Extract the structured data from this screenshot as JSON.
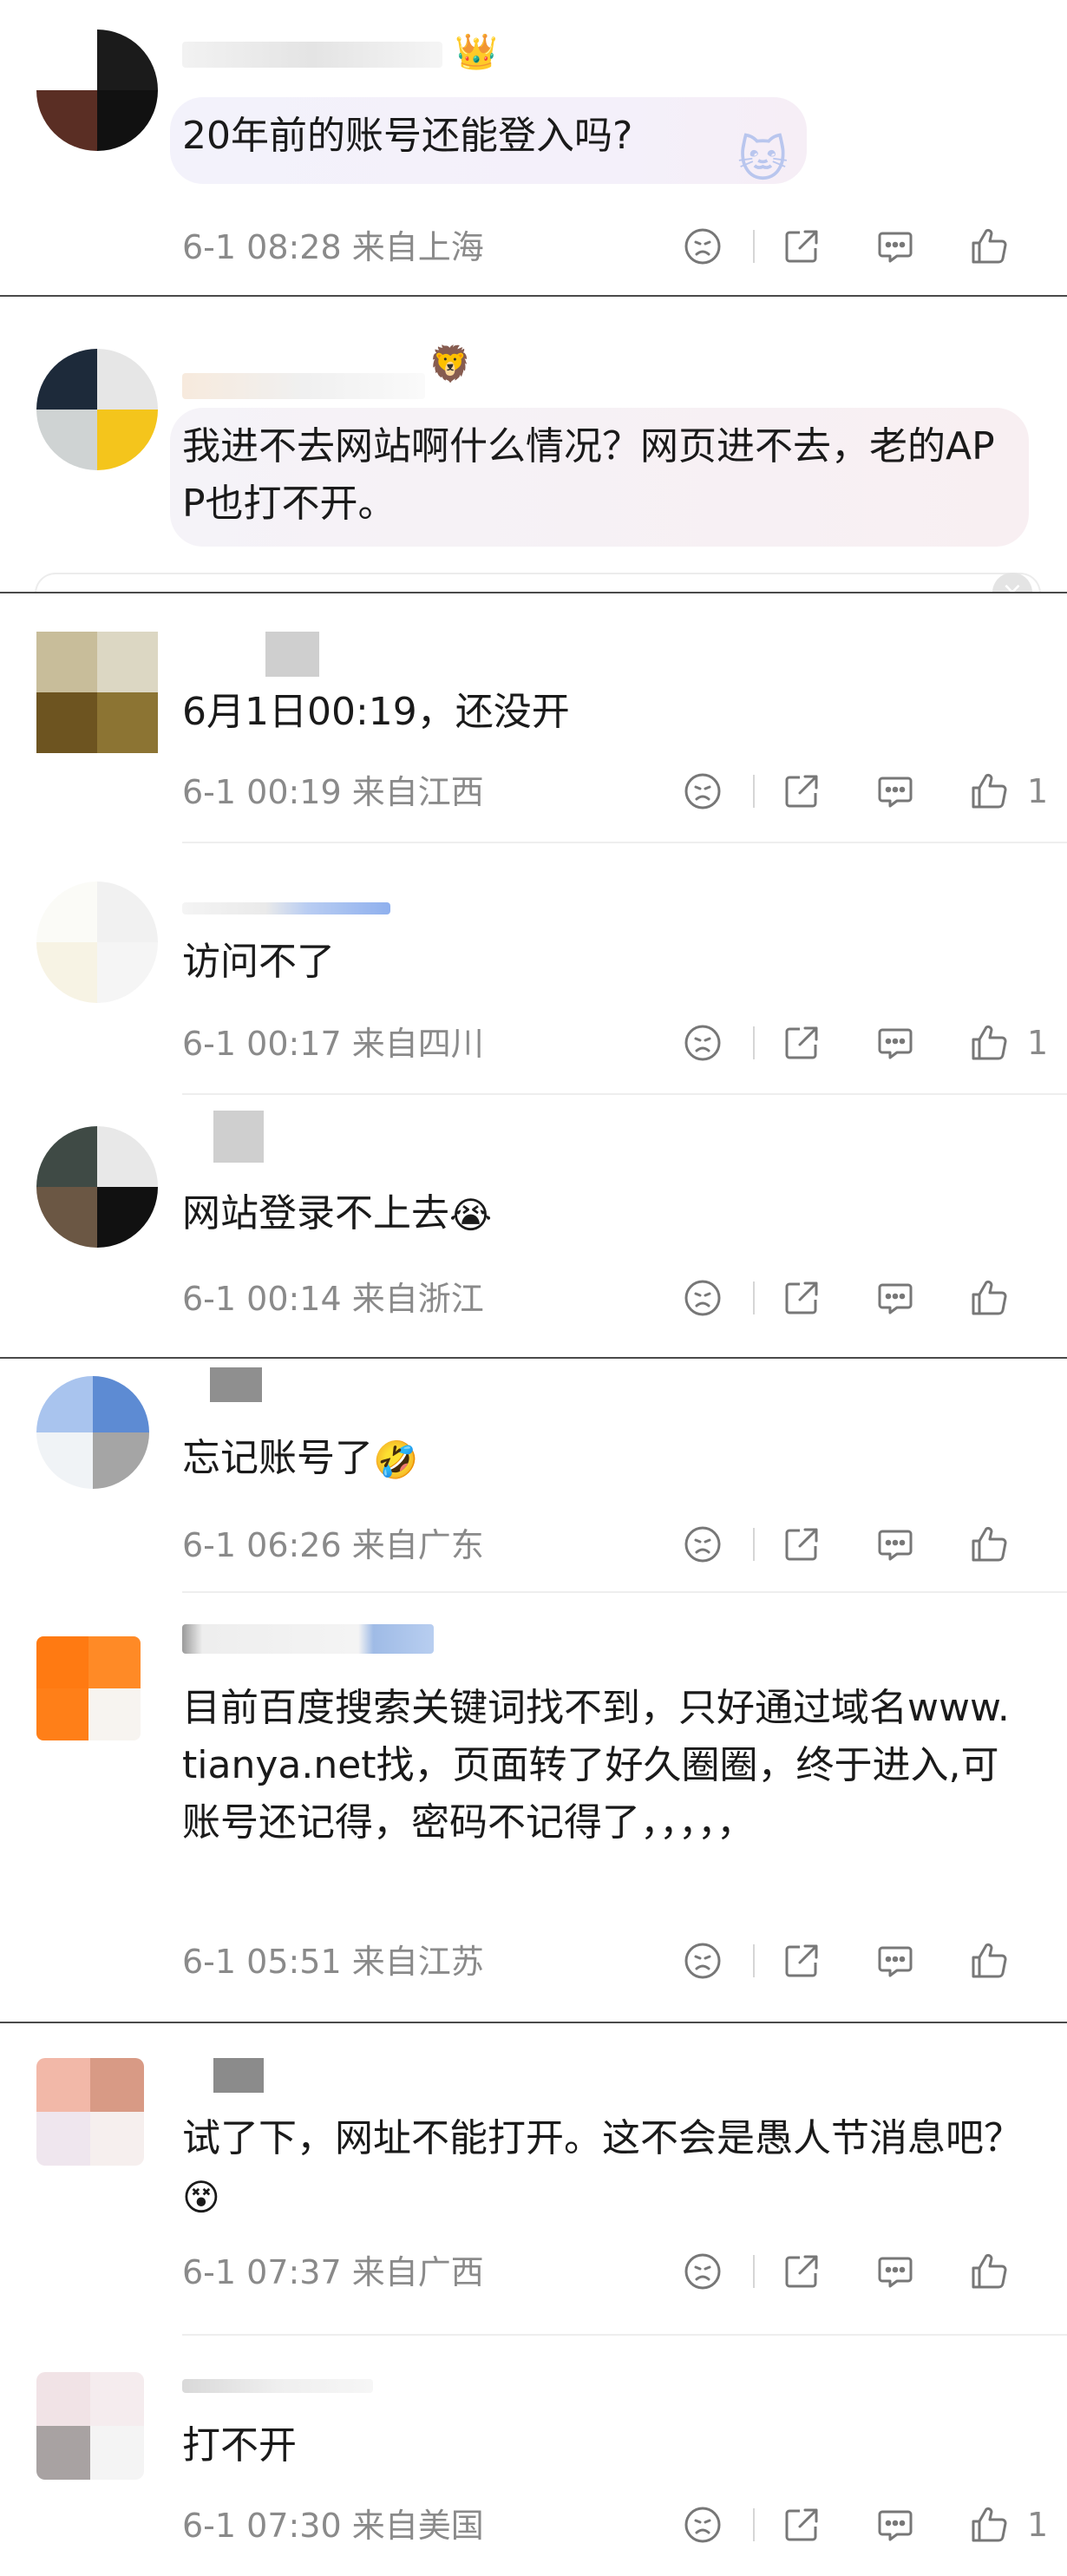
{
  "icons": {
    "dislike": "dislike-face-icon",
    "share": "share-icon",
    "comment": "comment-bubble-icon",
    "like": "thumbs-up-icon"
  },
  "colors": {
    "meta": "#8a8a8a",
    "divider": "#4a4a4a"
  },
  "comments": [
    {
      "text": "20年前的账号还能登入吗?",
      "time": "6-1 08:28",
      "location": "来自上海",
      "likes": ""
    },
    {
      "text": "我进不去网站啊什么情况？网页进不去，老的APP也打不开。"
    },
    {
      "text": "6月1日00:19，还没开",
      "time": "6-1 00:19",
      "location": "来自江西",
      "likes": "1"
    },
    {
      "text": "访问不了",
      "time": "6-1 00:17",
      "location": "来自四川",
      "likes": "1"
    },
    {
      "text": "网站登录不上去",
      "emoji": "😭",
      "time": "6-1 00:14",
      "location": "来自浙江",
      "likes": ""
    },
    {
      "text": "忘记账号了",
      "emoji": "🤣",
      "time": "6-1 06:26",
      "location": "来自广东",
      "likes": ""
    },
    {
      "text": "目前百度搜索关键词找不到，只好通过域名www.tianya.net找，页面转了好久圈圈，终于进入,可账号还记得，密码不记得了，，，，，",
      "time": "6-1 05:51",
      "location": "来自江苏",
      "likes": ""
    },
    {
      "text": "试了下，网址不能打开。这不会是愚人节消息吧？",
      "emoji": "😵",
      "time": "6-1 07:37",
      "location": "来自广西",
      "likes": ""
    },
    {
      "text": "打不开",
      "time": "6-1 07:30",
      "location": "来自美国",
      "likes": "1"
    }
  ]
}
